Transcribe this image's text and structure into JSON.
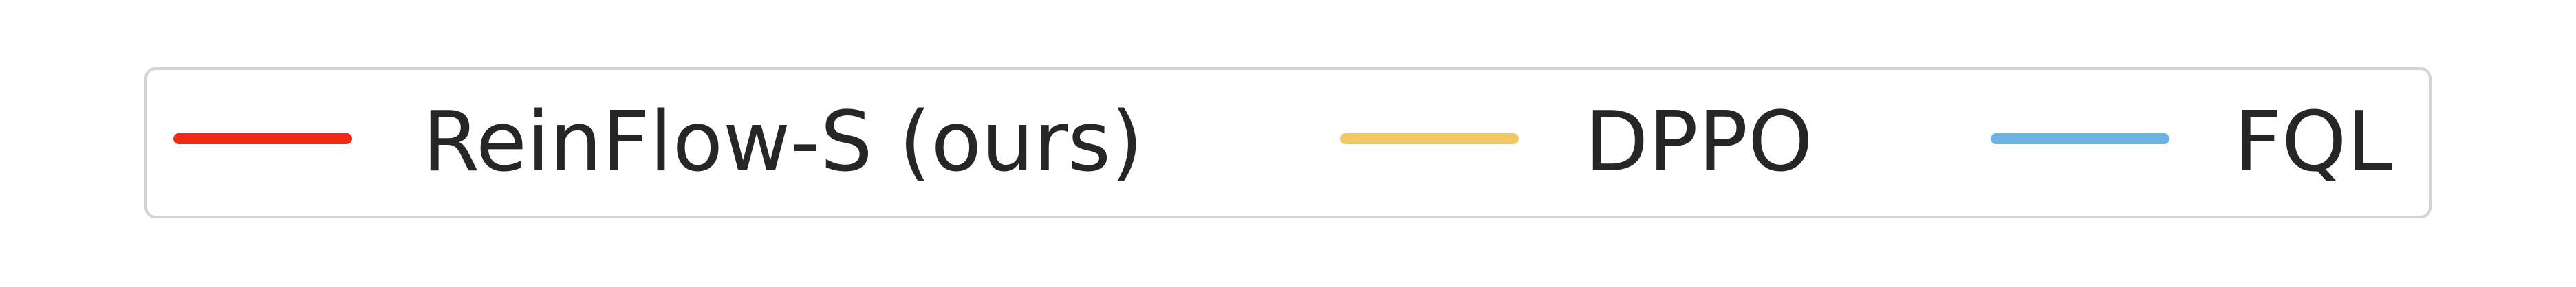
{
  "chart_data": {
    "type": "line",
    "legend": [
      {
        "label": "ReinFlow-S (ours)",
        "color": "#ee2a12"
      },
      {
        "label": "DPPO",
        "color": "#f2c766"
      },
      {
        "label": "FQL",
        "color": "#6cb2e3"
      }
    ],
    "legend_placement": "top"
  }
}
